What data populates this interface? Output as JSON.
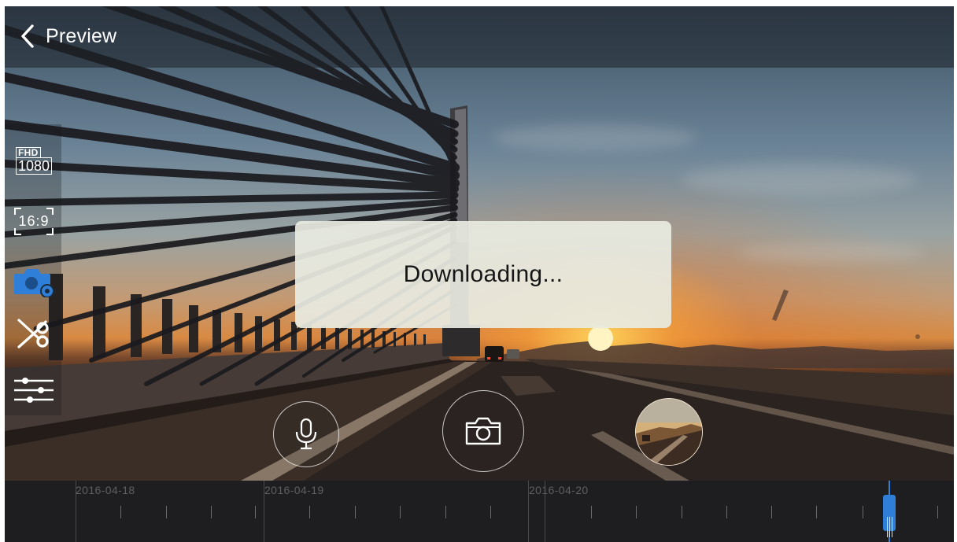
{
  "header": {
    "title": "Preview"
  },
  "toolbar": {
    "resolution": {
      "top": "FHD",
      "bottom": "1080"
    },
    "aspect_ratio": "16:9",
    "items": [
      "resolution-icon",
      "aspect-ratio-icon",
      "camera-mode-icon",
      "scissors-icon",
      "sliders-icon"
    ]
  },
  "dialog": {
    "message": "Downloading..."
  },
  "controls": {
    "mic": "microphone-icon",
    "snapshot": "camera-icon",
    "thumbnail": "gallery-thumbnail"
  },
  "timeline": {
    "dates": [
      "2016-04-18",
      "2016-04-19",
      "2016-04-20"
    ]
  },
  "colors": {
    "accent": "#2f7fd8",
    "dialog_bg": "#e8ebe1",
    "timeline_bg": "#1e1e20"
  }
}
